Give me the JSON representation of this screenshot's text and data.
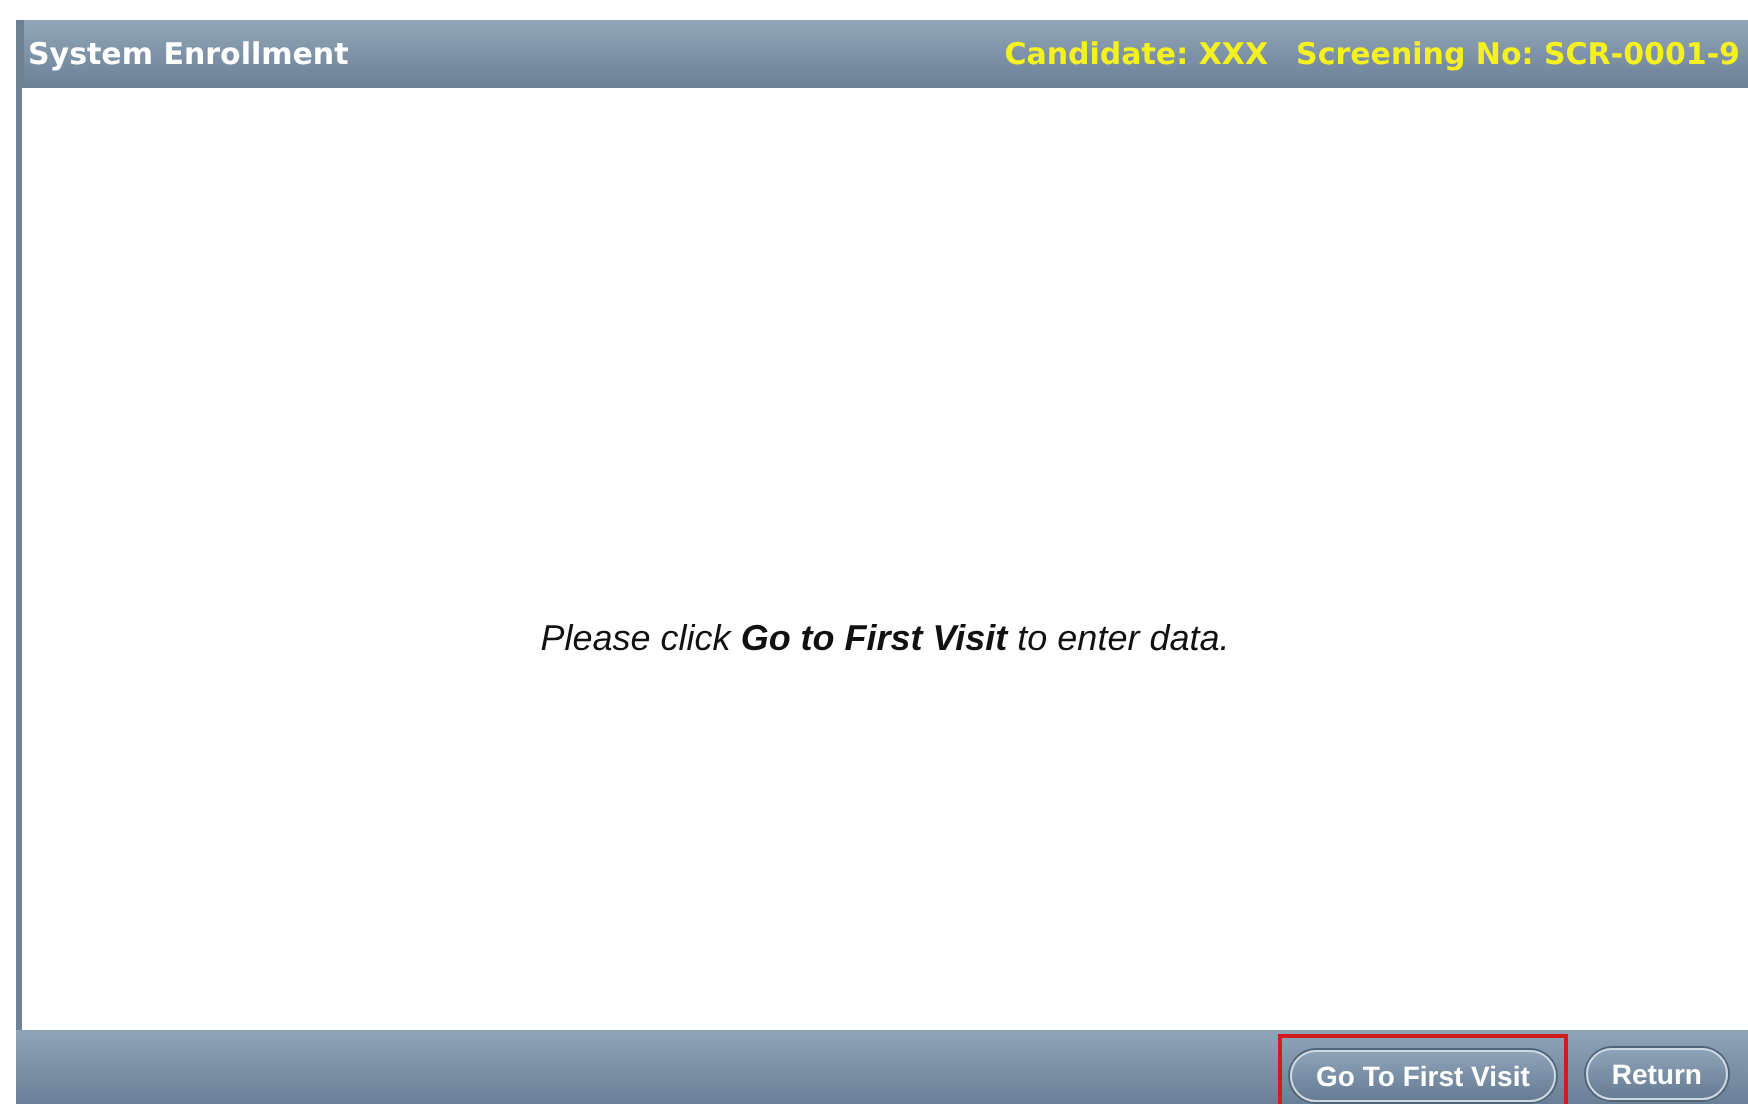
{
  "header": {
    "title": "System Enrollment",
    "candidate": "Candidate: XXX",
    "screening": "Screening No: SCR-0001-9"
  },
  "message": "Please click **Go to First Visit** to enter data.",
  "buttons": [
    {
      "label": "Go To First Visit",
      "highlighted": true
    },
    {
      "label": "Return",
      "highlighted": false
    }
  ]
}
